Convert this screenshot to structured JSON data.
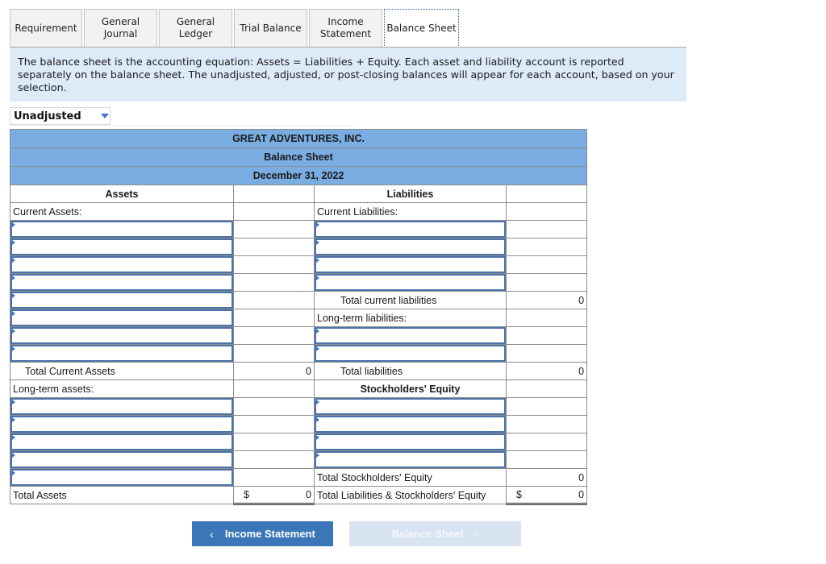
{
  "tabs": [
    {
      "label": "Requirement",
      "active": false
    },
    {
      "label": "General\nJournal",
      "active": false
    },
    {
      "label": "General\nLedger",
      "active": false
    },
    {
      "label": "Trial Balance",
      "active": false
    },
    {
      "label": "Income\nStatement",
      "active": false
    },
    {
      "label": "Balance Sheet",
      "active": true
    }
  ],
  "info_text": "The balance sheet is the accounting equation: Assets = Liabilities + Equity. Each asset and liability account is reported separately on the balance sheet. The unadjusted, adjusted, or post-closing balances will appear for each account, based on your selection.",
  "balance_selector": {
    "value": "Unadjusted",
    "icon": "dropdown-arrow-icon"
  },
  "sheet": {
    "company": "GREAT ADVENTURES, INC.",
    "title": "Balance Sheet",
    "date": "December 31, 2022",
    "assets_header": "Assets",
    "liabilities_header": "Liabilities",
    "current_assets_label": "Current Assets:",
    "current_liabilities_label": "Current Liabilities:",
    "total_current_liabilities_label": "Total current liabilities",
    "total_current_liabilities_value": "0",
    "long_term_liabilities_label": "Long-term liabilities:",
    "total_current_assets_label": "Total Current Assets",
    "total_current_assets_value": "0",
    "total_liabilities_label": "Total liabilities",
    "total_liabilities_value": "0",
    "long_term_assets_label": "Long-term assets:",
    "stockholders_equity_header": "Stockholders' Equity",
    "total_stockholders_equity_label": "Total Stockholders' Equity",
    "total_stockholders_equity_value": "0",
    "total_assets_label": "Total Assets",
    "total_assets_currency": "$",
    "total_assets_value": "0",
    "total_liab_equity_label": "Total Liabilities & Stockholders' Equity",
    "total_liab_equity_currency": "$",
    "total_liab_equity_value": "0"
  },
  "nav": {
    "prev_label": "Income Statement",
    "next_label": "Balance Sheet",
    "prev_icon": "‹",
    "next_icon": "›"
  }
}
